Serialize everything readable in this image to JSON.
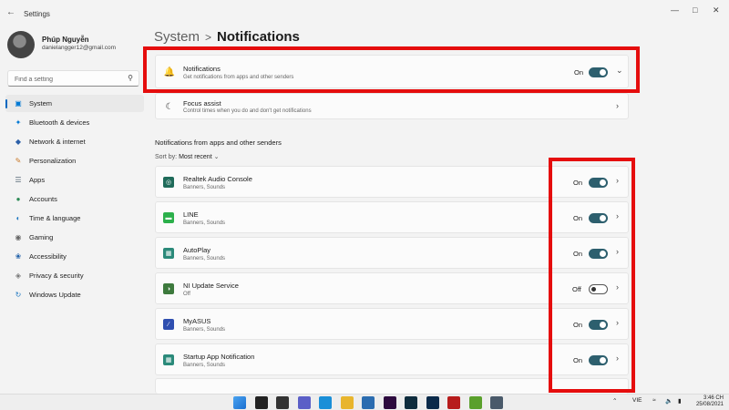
{
  "window": {
    "title": "Settings",
    "back_icon": "back-arrow-icon"
  },
  "user": {
    "name": "Phúp Nguyễn",
    "email": "danielangger12@gmail.com"
  },
  "search": {
    "placeholder": "Find a setting"
  },
  "nav": [
    {
      "label": "System",
      "icon": "system-icon",
      "active": true,
      "color": "#0078d4"
    },
    {
      "label": "Bluetooth & devices",
      "icon": "bluetooth-icon",
      "color": "#0078d4"
    },
    {
      "label": "Network & internet",
      "icon": "network-icon",
      "color": "#2b5fa8"
    },
    {
      "label": "Personalization",
      "icon": "brush-icon",
      "color": "#c97a2a"
    },
    {
      "label": "Apps",
      "icon": "apps-icon",
      "color": "#5a6b7a"
    },
    {
      "label": "Accounts",
      "icon": "accounts-icon",
      "color": "#2e8b57"
    },
    {
      "label": "Time & language",
      "icon": "globe-icon",
      "color": "#1f78c1"
    },
    {
      "label": "Gaming",
      "icon": "gaming-icon",
      "color": "#666"
    },
    {
      "label": "Accessibility",
      "icon": "accessibility-icon",
      "color": "#1f5fa8"
    },
    {
      "label": "Privacy & security",
      "icon": "shield-icon",
      "color": "#777"
    },
    {
      "label": "Windows Update",
      "icon": "update-icon",
      "color": "#1f78c1"
    }
  ],
  "breadcrumb": {
    "parent": "System",
    "separator": ">",
    "current": "Notifications"
  },
  "notifications": {
    "title": "Notifications",
    "subtitle": "Get notifications from apps and other senders",
    "state": "On",
    "on": true
  },
  "focus": {
    "title": "Focus assist",
    "subtitle": "Control times when you do and don't get notifications"
  },
  "apps_section": {
    "heading": "Notifications from apps and other senders",
    "sort_label": "Sort by:",
    "sort_value": "Most recent"
  },
  "apps": [
    {
      "name": "Realtek Audio Console",
      "sub": "Banners, Sounds",
      "state": "On",
      "on": true,
      "icon": "realtek-icon",
      "color": "#1f6b5a"
    },
    {
      "name": "LINE",
      "sub": "Banners, Sounds",
      "state": "On",
      "on": true,
      "icon": "line-icon",
      "color": "#2cb04b"
    },
    {
      "name": "AutoPlay",
      "sub": "Banners, Sounds",
      "state": "On",
      "on": true,
      "icon": "autoplay-icon",
      "color": "#2b8a7a"
    },
    {
      "name": "NI Update Service",
      "sub": "Off",
      "state": "Off",
      "on": false,
      "icon": "ni-update-icon",
      "color": "#3d7a3d"
    },
    {
      "name": "MyASUS",
      "sub": "Banners, Sounds",
      "state": "On",
      "on": true,
      "icon": "myasus-icon",
      "color": "#2f4fb0"
    },
    {
      "name": "Startup App Notification",
      "sub": "Banners, Sounds",
      "state": "On",
      "on": true,
      "icon": "startup-icon",
      "color": "#2b8a7a"
    }
  ],
  "taskbar": {
    "icons": [
      "windows-start-icon",
      "search-icon",
      "task-view-icon",
      "chat-icon",
      "edge-icon",
      "file-explorer-icon",
      "mail-icon",
      "premiere-icon",
      "lightroom-icon",
      "photoshop-icon",
      "acrobat-icon",
      "green-app-icon",
      "settings-icon"
    ]
  },
  "tray": {
    "lang": "VIE",
    "time": "3:46 CH",
    "date": "25/08/2021"
  },
  "accent": "#e50d0d"
}
